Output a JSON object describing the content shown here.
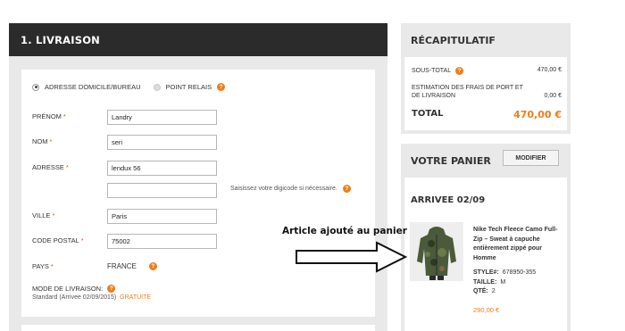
{
  "delivery": {
    "title": "1. LIVRAISON",
    "options": [
      {
        "label": "ADRESSE DOMICILE/BUREAU",
        "selected": true
      },
      {
        "label": "POINT RELAIS",
        "selected": false
      }
    ],
    "help_glyph": "?",
    "fields": {
      "firstname": {
        "label": "PRÉNOM",
        "value": "Landry"
      },
      "lastname": {
        "label": "NOM",
        "value": "seri"
      },
      "address": {
        "label": "ADRESSE",
        "value": "lendux 56"
      },
      "address2": {
        "value": "",
        "hint": "Saisissez votre digicode si nécessaire."
      },
      "city": {
        "label": "VILLE",
        "value": "Paris"
      },
      "postcode": {
        "label": "CODE POSTAL",
        "value": "75002"
      },
      "country": {
        "label": "PAYS",
        "value": "FRANCE"
      }
    },
    "required_mark": "*",
    "mode": {
      "label": "MODE DE LIVRAISON:",
      "value": "Standard (Arrivee 02/09/2015)",
      "price": "GRATUITE"
    }
  },
  "summary": {
    "title": "RÉCAPITULATIF",
    "subtotal_label": "SOUS-TOTAL",
    "subtotal_value": "470,00 €",
    "shipping_label": "ESTIMATION DES FRAIS DE PORT ET DE LIVRAISON",
    "shipping_value": "0,00 €",
    "total_label": "TOTAL",
    "total_value": "470,00 €"
  },
  "cart": {
    "title": "VOTRE PANIER",
    "modify_label": "MODIFIER",
    "arrival": "ARRIVEE 02/09",
    "product": {
      "name": "Nike Tech Fleece Camo Full-Zip – Sweat à capuche entièrement zippé pour Homme",
      "style_label": "STYLE#:",
      "style_value": "678950-355",
      "size_label": "TAILLE:",
      "size_value": "M",
      "qty_label": "QTÉ:",
      "qty_value": "2",
      "price": "290,00 €"
    }
  },
  "annotation": {
    "text": "Article ajouté au panier"
  },
  "colors": {
    "accent": "#f07d19",
    "header_dark": "#2b2b2b",
    "panel_gray": "#e9e9e9"
  }
}
